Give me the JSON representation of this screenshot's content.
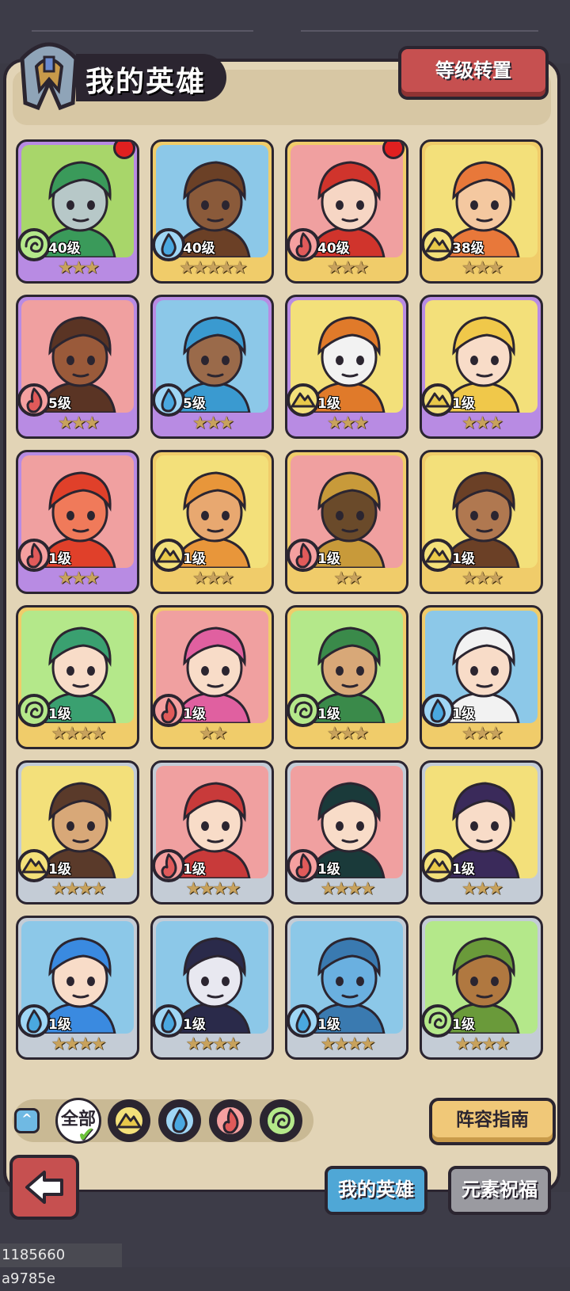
{
  "header": {
    "title": "我的英雄",
    "reset_button": "等级转置"
  },
  "elements": {
    "earth": {
      "ring": "#e8c84a",
      "fill": "#f3e07a",
      "stroke": "#2b2530"
    },
    "water": {
      "ring": "#4aa8e0",
      "fill": "#9fd6f5",
      "stroke": "#2b2530"
    },
    "fire": {
      "ring": "#e05a5a",
      "fill": "#f5a0a0",
      "stroke": "#2b2530"
    },
    "nature": {
      "ring": "#6cc43a",
      "fill": "#b4e88a",
      "stroke": "#2b2530"
    }
  },
  "rarity_colors": {
    "purple": "#b88be3",
    "gold": "#f0cc6a",
    "silver": "#c4ccd6"
  },
  "heroes": [
    {
      "level": "40级",
      "stars": 3,
      "element": "nature",
      "rarity": "purple",
      "bg": "#a8d66a",
      "skin": "#b7c8c8",
      "hair": "#3a9a5a",
      "dot": true
    },
    {
      "level": "40级",
      "stars": 5,
      "element": "water",
      "rarity": "gold",
      "bg": "#8cc8e8",
      "skin": "#8a5a3a",
      "hair": "#6b4026",
      "dot": false
    },
    {
      "level": "40级",
      "stars": 3,
      "element": "fire",
      "rarity": "gold",
      "bg": "#f0a0a0",
      "skin": "#f6d6c4",
      "hair": "#d0342c",
      "dot": true
    },
    {
      "level": "38级",
      "stars": 3,
      "element": "earth",
      "rarity": "gold",
      "bg": "#f3e07a",
      "skin": "#f4c8a0",
      "hair": "#e8783a",
      "dot": false
    },
    {
      "level": "5级",
      "stars": 3,
      "element": "fire",
      "rarity": "purple",
      "bg": "#f0a0a0",
      "skin": "#9a5a3a",
      "hair": "#5a3424",
      "dot": false
    },
    {
      "level": "5级",
      "stars": 3,
      "element": "water",
      "rarity": "purple",
      "bg": "#8cc8e8",
      "skin": "#9a6a4a",
      "hair": "#3a9ad0",
      "dot": false
    },
    {
      "level": "1级",
      "stars": 3,
      "element": "earth",
      "rarity": "purple",
      "bg": "#f3e07a",
      "skin": "#f2f2f2",
      "hair": "#e07a2a",
      "dot": false
    },
    {
      "level": "1级",
      "stars": 3,
      "element": "earth",
      "rarity": "purple",
      "bg": "#f3e07a",
      "skin": "#f8dcc8",
      "hair": "#f0c84a",
      "dot": false
    },
    {
      "level": "1级",
      "stars": 3,
      "element": "fire",
      "rarity": "purple",
      "bg": "#f0a0a0",
      "skin": "#f07a5a",
      "hair": "#e0402a",
      "dot": false
    },
    {
      "level": "1级",
      "stars": 3,
      "element": "earth",
      "rarity": "gold",
      "bg": "#f3e07a",
      "skin": "#e8a870",
      "hair": "#e8963a",
      "dot": false
    },
    {
      "level": "1级",
      "stars": 2,
      "element": "fire",
      "rarity": "gold",
      "bg": "#f0a0a0",
      "skin": "#6a4a2a",
      "hair": "#c89a3a",
      "dot": false
    },
    {
      "level": "1级",
      "stars": 3,
      "element": "earth",
      "rarity": "gold",
      "bg": "#f3e07a",
      "skin": "#b07850",
      "hair": "#6b4026",
      "dot": false
    },
    {
      "level": "1级",
      "stars": 4,
      "element": "nature",
      "rarity": "gold",
      "bg": "#b4e88a",
      "skin": "#f8dcc8",
      "hair": "#3aa070",
      "dot": false
    },
    {
      "level": "1级",
      "stars": 2,
      "element": "fire",
      "rarity": "gold",
      "bg": "#f0a0a0",
      "skin": "#f8dcc8",
      "hair": "#e060a0",
      "dot": false
    },
    {
      "level": "1级",
      "stars": 3,
      "element": "nature",
      "rarity": "gold",
      "bg": "#b4e88a",
      "skin": "#d8a878",
      "hair": "#3a8a4a",
      "dot": false
    },
    {
      "level": "1级",
      "stars": 3,
      "element": "water",
      "rarity": "gold",
      "bg": "#8cc8e8",
      "skin": "#f8dcc8",
      "hair": "#f2f2f2",
      "dot": false
    },
    {
      "level": "1级",
      "stars": 4,
      "element": "earth",
      "rarity": "silver",
      "bg": "#f3e07a",
      "skin": "#d8a878",
      "hair": "#5a3a2a",
      "dot": false
    },
    {
      "level": "1级",
      "stars": 4,
      "element": "fire",
      "rarity": "silver",
      "bg": "#f0a0a0",
      "skin": "#f8dcc8",
      "hair": "#c83a3a",
      "dot": false
    },
    {
      "level": "1级",
      "stars": 4,
      "element": "fire",
      "rarity": "silver",
      "bg": "#f0a0a0",
      "skin": "#f8dcc8",
      "hair": "#1a3a3a",
      "dot": false
    },
    {
      "level": "1级",
      "stars": 3,
      "element": "earth",
      "rarity": "silver",
      "bg": "#f3e07a",
      "skin": "#f8dcc8",
      "hair": "#3a2a5a",
      "dot": false
    },
    {
      "level": "1级",
      "stars": 4,
      "element": "water",
      "rarity": "silver",
      "bg": "#8cc8e8",
      "skin": "#f8dcc8",
      "hair": "#3a8ae0",
      "dot": false
    },
    {
      "level": "1级",
      "stars": 4,
      "element": "water",
      "rarity": "silver",
      "bg": "#8cc8e8",
      "skin": "#e8e8f0",
      "hair": "#2a2a4a",
      "dot": false
    },
    {
      "level": "1级",
      "stars": 4,
      "element": "water",
      "rarity": "silver",
      "bg": "#8cc8e8",
      "skin": "#6ab0e0",
      "hair": "#3a7ab0",
      "dot": false
    },
    {
      "level": "1级",
      "stars": 4,
      "element": "nature",
      "rarity": "silver",
      "bg": "#b4e88a",
      "skin": "#b07840",
      "hair": "#6a9a3a",
      "dot": false
    }
  ],
  "filters": {
    "all_label": "全部",
    "elements": [
      "earth",
      "water",
      "fire",
      "nature"
    ],
    "selected": "all"
  },
  "guide_button": "阵容指南",
  "tabs": [
    {
      "label": "我的英雄",
      "active": true
    },
    {
      "label": "元素祝福",
      "active": false
    }
  ],
  "footer_code": "1185660 a9785e"
}
